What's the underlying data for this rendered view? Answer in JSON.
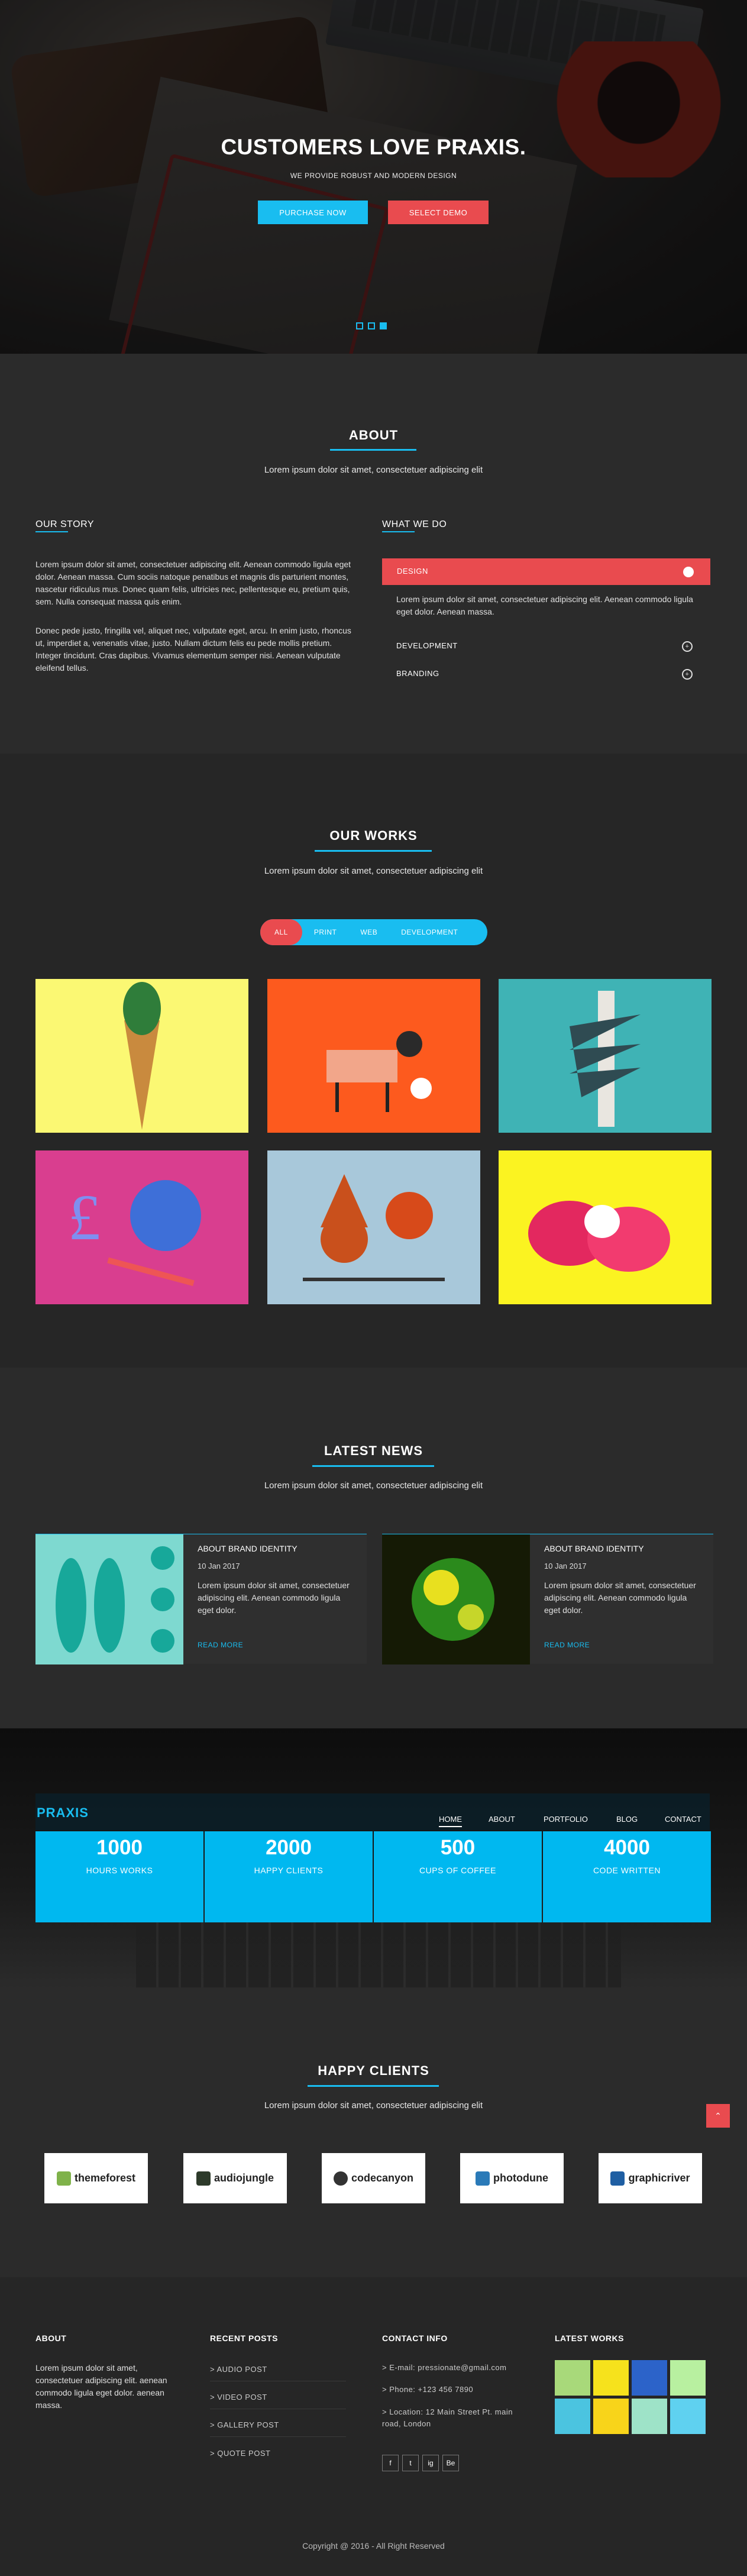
{
  "hero": {
    "title": "CUSTOMERS LOVE PRAXIS.",
    "tagline": "WE PROVIDE ROBUST AND MODERN DESIGN",
    "btn_primary": "PURCHASE NOW",
    "btn_secondary": "SELECT DEMO",
    "slides": 3,
    "active_slide": 3
  },
  "about": {
    "title": "ABOUT",
    "subtitle": "Lorem ipsum dolor sit amet, consectetuer adipiscing elit",
    "story_heading": "OUR STORY",
    "story_p1": "Lorem ipsum dolor sit amet, consectetuer adipiscing elit. Aenean commodo ligula eget dolor. Aenean massa. Cum sociis natoque penatibus et magnis dis parturient montes, nascetur ridiculus mus. Donec quam felis, ultricies nec, pellentesque eu, pretium quis, sem. Nulla consequat massa quis enim.",
    "story_p2": "Donec pede justo, fringilla vel, aliquet nec, vulputate eget, arcu. In enim justo, rhoncus ut, imperdiet a, venenatis vitae, justo. Nullam dictum felis eu pede mollis pretium. Integer tincidunt. Cras dapibus. Vivamus elementum semper nisi. Aenean vulputate eleifend tellus.",
    "whatwedo_heading": "WHAT WE DO",
    "acc_open": "DESIGN",
    "acc_body": "Lorem ipsum dolor sit amet, consectetuer adipiscing elit. Aenean commodo ligula eget dolor. Aenean massa.",
    "acc_dev": "DEVELOPMENT",
    "acc_brand": "BRANDING"
  },
  "works": {
    "title": "OUR WORKS",
    "subtitle": "Lorem ipsum dolor sit amet, consectetuer adipiscing elit",
    "filters": [
      "ALL",
      "PRINT",
      "WEB",
      "DEVELOPMENT"
    ]
  },
  "news": {
    "title": "LATEST NEWS",
    "subtitle": "Lorem ipsum dolor sit amet, consectetuer adipiscing elit",
    "items": [
      {
        "heading": "ABOUT BRAND IDENTITY",
        "date": "10 Jan 2017",
        "text": "Lorem ipsum dolor sit amet, consectetuer adipiscing elit. Aenean commodo ligula eget dolor.",
        "more": "READ MORE"
      },
      {
        "heading": "ABOUT BRAND IDENTITY",
        "date": "10 Jan 2017",
        "text": "Lorem ipsum dolor sit amet, consectetuer adipiscing elit. Aenean commodo ligula eget dolor.",
        "more": "READ MORE"
      }
    ]
  },
  "navbar": {
    "logo": "PRAXIS",
    "items": [
      "HOME",
      "ABOUT",
      "PORTFOLIO",
      "BLOG",
      "CONTACT"
    ]
  },
  "counters": [
    {
      "value": "1000",
      "label": "HOURS WORKS"
    },
    {
      "value": "2000",
      "label": "HAPPY CLIENTS"
    },
    {
      "value": "500",
      "label": "CUPS OF COFFEE"
    },
    {
      "value": "4000",
      "label": "CODE WRITTEN"
    }
  ],
  "clients": {
    "title": "HAPPY CLIENTS",
    "subtitle": "Lorem ipsum dolor sit amet, consectetuer adipiscing elit",
    "logos": [
      "themeforest",
      "audiojungle",
      "codecanyon",
      "photodune",
      "graphicriver"
    ]
  },
  "footer": {
    "about_h": "ABOUT",
    "about_text": "Lorem ipsum dolor sit amet, consectetuer adipiscing elit. aenean commodo ligula eget dolor. aenean massa.",
    "recent_h": "RECENT POSTS",
    "posts": [
      "AUDIO POST",
      "VIDEO POST",
      "GALLERY POST",
      "QUOTE POST"
    ],
    "contact_h": "CONTACT INFO",
    "email": "E-mail: pressionate@gmail.com",
    "phone": "Phone: +123 456 7890",
    "location": "Location: 12 Main Street Pt. main road, London",
    "social": [
      "f",
      "t",
      "ig",
      "Be"
    ],
    "works_h": "LATEST WORKS",
    "copyright": "Copyright @ 2016 - All Right Reserved"
  },
  "colors": {
    "accent": "#19bdf0",
    "red": "#e94b4f",
    "bg_dark": "#262626",
    "bg_alt": "#2b2b2b"
  }
}
